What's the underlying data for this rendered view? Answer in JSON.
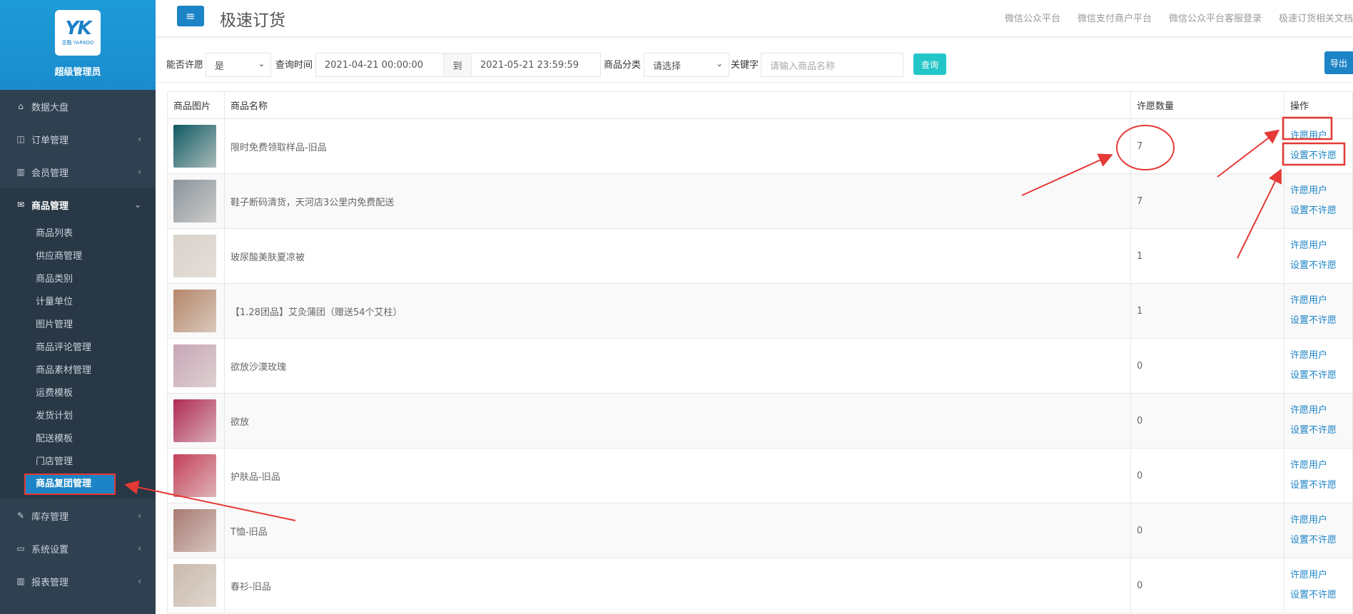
{
  "sidebar": {
    "logo_mark": "YK",
    "logo_sub": "亚酷 YARKOO",
    "role": "超级管理员",
    "items": [
      {
        "label": "数据大盘",
        "icon": "home-icon"
      },
      {
        "label": "订单管理",
        "icon": "columns-icon"
      },
      {
        "label": "会员管理",
        "icon": "bar-chart-icon"
      },
      {
        "label": "商品管理",
        "icon": "envelope-icon"
      }
    ],
    "sub_items": [
      "商品列表",
      "供应商管理",
      "商品类别",
      "计量单位",
      "图片管理",
      "商品评论管理",
      "商品素材管理",
      "运费模板",
      "发货计划",
      "配送模板",
      "门店管理",
      "商品复团管理"
    ],
    "items_after": [
      {
        "label": "库存管理",
        "icon": "edit-icon"
      },
      {
        "label": "系统设置",
        "icon": "desktop-icon"
      },
      {
        "label": "报表管理",
        "icon": "bar-chart-icon"
      }
    ]
  },
  "header": {
    "menu_icon": "≡",
    "title": "极速订货",
    "links": [
      "微信公众平台",
      "微信支付商户平台",
      "微信公众平台客服登录",
      "极速订货相关文档"
    ]
  },
  "filters": {
    "allow_label": "能否许愿",
    "allow_value": "是",
    "time_label": "查询时间",
    "time_from": "2021-04-21 00:00:00",
    "to_label": "到",
    "time_to": "2021-05-21 23:59:59",
    "category_label": "商品分类",
    "category_value": "请选择",
    "keyword_label": "关键字",
    "keyword_placeholder": "请输入商品名称",
    "query_button": "查询",
    "export_button": "导出"
  },
  "table": {
    "headers": [
      "商品图片",
      "商品名称",
      "许愿数量",
      "操作"
    ],
    "action_users": "许愿用户",
    "action_disable": "设置不许愿",
    "rows": [
      {
        "name": "限时免费领取样品-旧品",
        "count": "7",
        "color": "#0f5a63"
      },
      {
        "name": "鞋子断码清货，天河店3公里内免费配送",
        "count": "7",
        "color": "#8a949c"
      },
      {
        "name": "玻尿酸美肤夏凉被",
        "count": "1",
        "color": "#d9d3cc"
      },
      {
        "name": "【1.28团品】艾灸蒲团（赠送54个艾柱）",
        "count": "1",
        "color": "#b5876a"
      },
      {
        "name": "欲放沙漠玫瑰",
        "count": "0",
        "color": "#c7a6b6"
      },
      {
        "name": "欲放",
        "count": "0",
        "color": "#b02a55"
      },
      {
        "name": "护肤品-旧品",
        "count": "0",
        "color": "#c3405a"
      },
      {
        "name": "T恤-旧品",
        "count": "0",
        "color": "#a87a73"
      },
      {
        "name": "春衫-旧品",
        "count": "0",
        "color": "#c9b9ad"
      }
    ]
  },
  "colors": {
    "sidebar_bg": "#2f4050",
    "accent": "#1c84c6",
    "query_button": "#23c6c8",
    "annotation": "#e53935"
  }
}
